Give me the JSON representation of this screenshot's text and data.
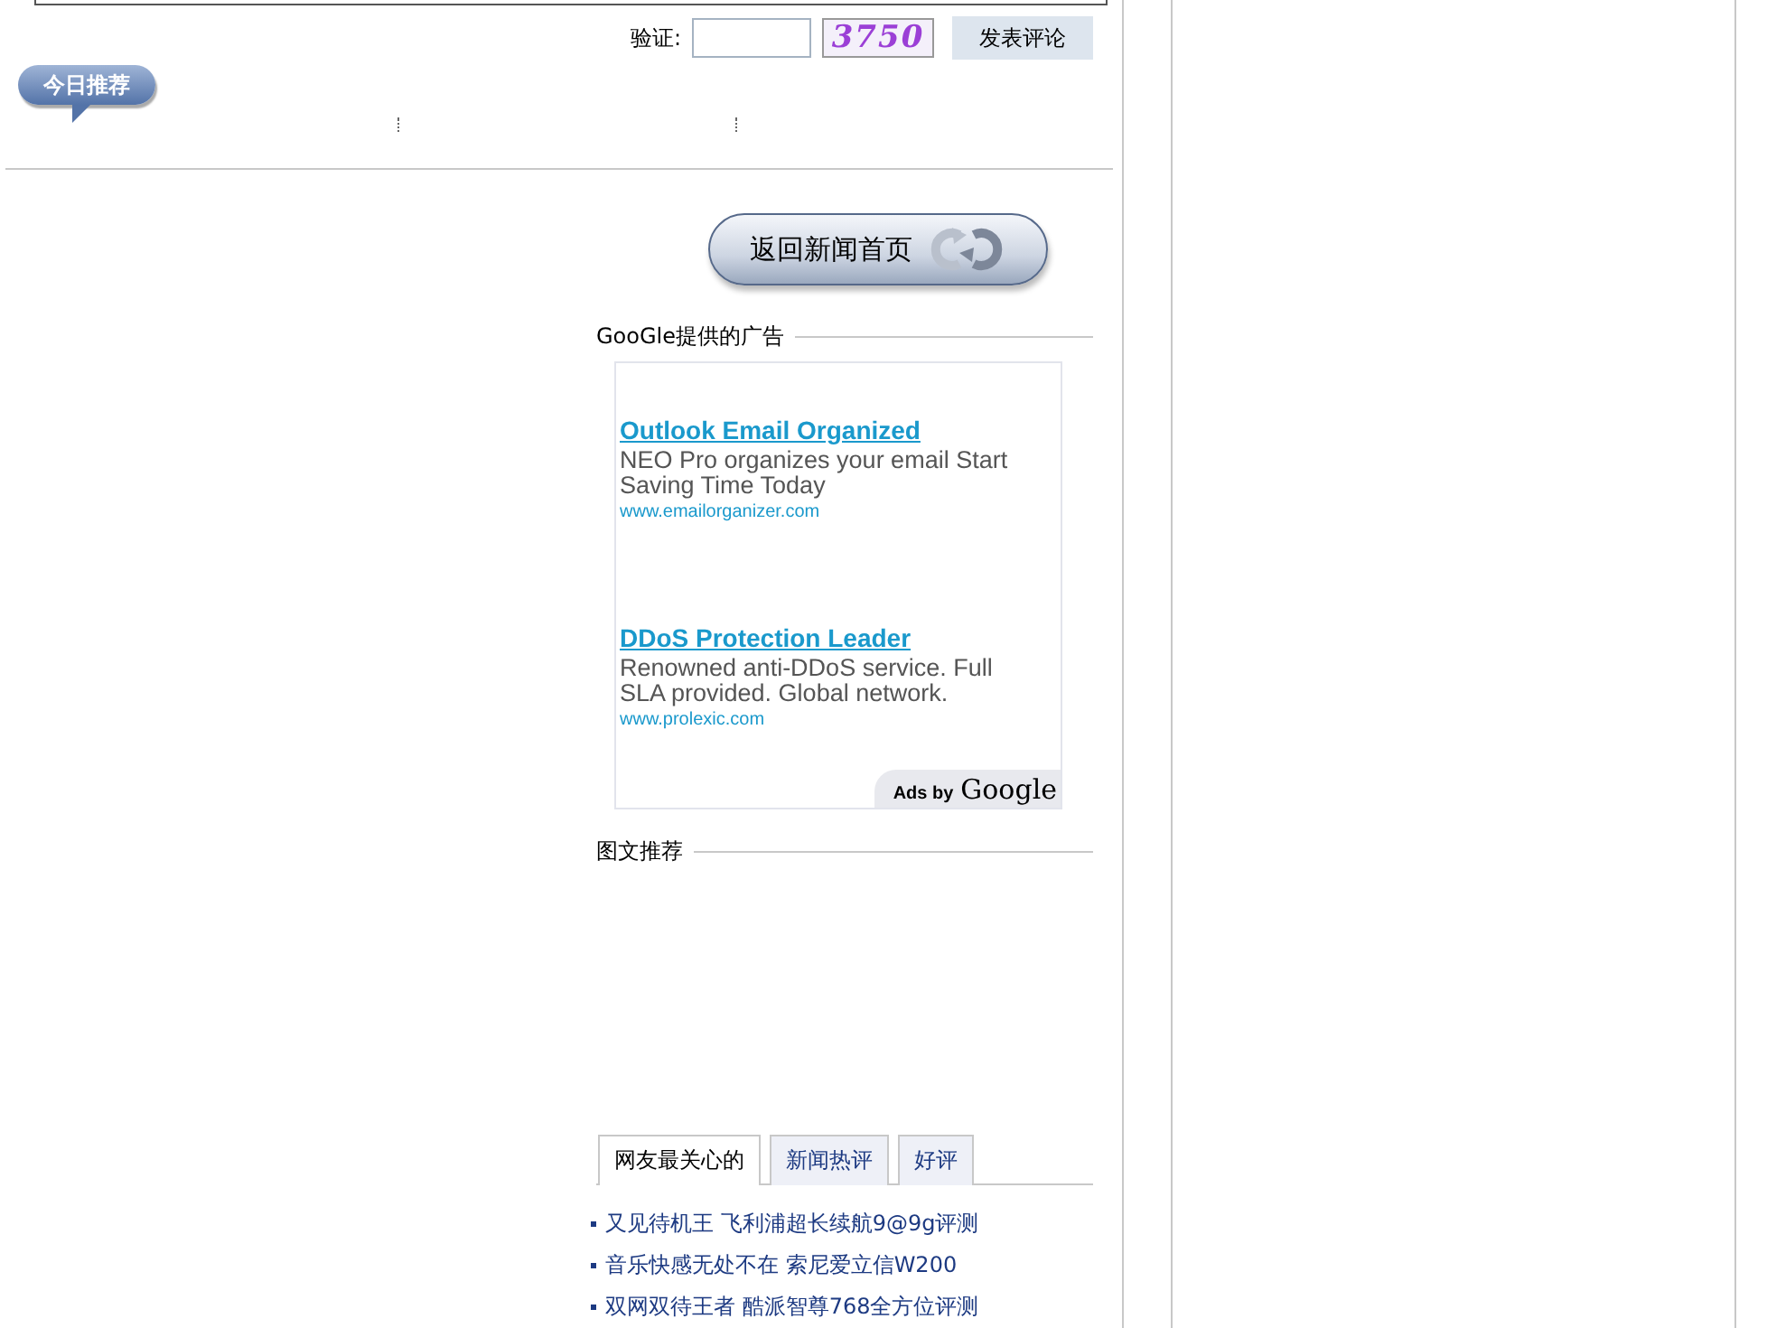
{
  "comment_form": {
    "captcha_label": "验证:",
    "captcha_image": "3750",
    "submit_button": "发表评论"
  },
  "today_badge": "今日推荐",
  "back_button": "返回新闻首页",
  "ads_section": {
    "title": "GooGle提供的广告",
    "ads": [
      {
        "title": "Outlook Email Organized",
        "text": "NEO Pro organizes your email Start Saving Time Today",
        "url": "www.emailorganizer.com"
      },
      {
        "title": "DDoS Protection Leader",
        "text": "Renowned anti-DDoS service. Full SLA provided. Global network.",
        "url": "www.prolexic.com"
      }
    ],
    "ads_by": "Ads by",
    "ads_brand": "Google"
  },
  "picture_section": {
    "title": "图文推荐"
  },
  "tabs": [
    {
      "label": "网友最关心的",
      "selected": true
    },
    {
      "label": "新闻热评",
      "selected": false
    },
    {
      "label": "好评",
      "selected": false
    }
  ],
  "articles": [
    "又见待机王 飞利浦超长续航9@9g评测",
    "音乐快感无处不在 索尼爱立信W200",
    "双网双待王者 酷派智尊768全方位评测"
  ]
}
